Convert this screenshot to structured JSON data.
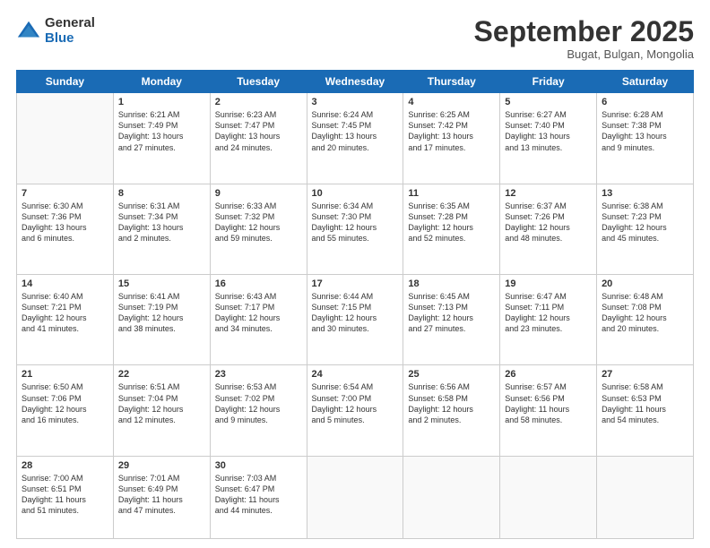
{
  "logo": {
    "general": "General",
    "blue": "Blue"
  },
  "header": {
    "month": "September 2025",
    "location": "Bugat, Bulgan, Mongolia"
  },
  "weekdays": [
    "Sunday",
    "Monday",
    "Tuesday",
    "Wednesday",
    "Thursday",
    "Friday",
    "Saturday"
  ],
  "weeks": [
    [
      {
        "day": "",
        "content": ""
      },
      {
        "day": "1",
        "content": "Sunrise: 6:21 AM\nSunset: 7:49 PM\nDaylight: 13 hours\nand 27 minutes."
      },
      {
        "day": "2",
        "content": "Sunrise: 6:23 AM\nSunset: 7:47 PM\nDaylight: 13 hours\nand 24 minutes."
      },
      {
        "day": "3",
        "content": "Sunrise: 6:24 AM\nSunset: 7:45 PM\nDaylight: 13 hours\nand 20 minutes."
      },
      {
        "day": "4",
        "content": "Sunrise: 6:25 AM\nSunset: 7:42 PM\nDaylight: 13 hours\nand 17 minutes."
      },
      {
        "day": "5",
        "content": "Sunrise: 6:27 AM\nSunset: 7:40 PM\nDaylight: 13 hours\nand 13 minutes."
      },
      {
        "day": "6",
        "content": "Sunrise: 6:28 AM\nSunset: 7:38 PM\nDaylight: 13 hours\nand 9 minutes."
      }
    ],
    [
      {
        "day": "7",
        "content": "Sunrise: 6:30 AM\nSunset: 7:36 PM\nDaylight: 13 hours\nand 6 minutes."
      },
      {
        "day": "8",
        "content": "Sunrise: 6:31 AM\nSunset: 7:34 PM\nDaylight: 13 hours\nand 2 minutes."
      },
      {
        "day": "9",
        "content": "Sunrise: 6:33 AM\nSunset: 7:32 PM\nDaylight: 12 hours\nand 59 minutes."
      },
      {
        "day": "10",
        "content": "Sunrise: 6:34 AM\nSunset: 7:30 PM\nDaylight: 12 hours\nand 55 minutes."
      },
      {
        "day": "11",
        "content": "Sunrise: 6:35 AM\nSunset: 7:28 PM\nDaylight: 12 hours\nand 52 minutes."
      },
      {
        "day": "12",
        "content": "Sunrise: 6:37 AM\nSunset: 7:26 PM\nDaylight: 12 hours\nand 48 minutes."
      },
      {
        "day": "13",
        "content": "Sunrise: 6:38 AM\nSunset: 7:23 PM\nDaylight: 12 hours\nand 45 minutes."
      }
    ],
    [
      {
        "day": "14",
        "content": "Sunrise: 6:40 AM\nSunset: 7:21 PM\nDaylight: 12 hours\nand 41 minutes."
      },
      {
        "day": "15",
        "content": "Sunrise: 6:41 AM\nSunset: 7:19 PM\nDaylight: 12 hours\nand 38 minutes."
      },
      {
        "day": "16",
        "content": "Sunrise: 6:43 AM\nSunset: 7:17 PM\nDaylight: 12 hours\nand 34 minutes."
      },
      {
        "day": "17",
        "content": "Sunrise: 6:44 AM\nSunset: 7:15 PM\nDaylight: 12 hours\nand 30 minutes."
      },
      {
        "day": "18",
        "content": "Sunrise: 6:45 AM\nSunset: 7:13 PM\nDaylight: 12 hours\nand 27 minutes."
      },
      {
        "day": "19",
        "content": "Sunrise: 6:47 AM\nSunset: 7:11 PM\nDaylight: 12 hours\nand 23 minutes."
      },
      {
        "day": "20",
        "content": "Sunrise: 6:48 AM\nSunset: 7:08 PM\nDaylight: 12 hours\nand 20 minutes."
      }
    ],
    [
      {
        "day": "21",
        "content": "Sunrise: 6:50 AM\nSunset: 7:06 PM\nDaylight: 12 hours\nand 16 minutes."
      },
      {
        "day": "22",
        "content": "Sunrise: 6:51 AM\nSunset: 7:04 PM\nDaylight: 12 hours\nand 12 minutes."
      },
      {
        "day": "23",
        "content": "Sunrise: 6:53 AM\nSunset: 7:02 PM\nDaylight: 12 hours\nand 9 minutes."
      },
      {
        "day": "24",
        "content": "Sunrise: 6:54 AM\nSunset: 7:00 PM\nDaylight: 12 hours\nand 5 minutes."
      },
      {
        "day": "25",
        "content": "Sunrise: 6:56 AM\nSunset: 6:58 PM\nDaylight: 12 hours\nand 2 minutes."
      },
      {
        "day": "26",
        "content": "Sunrise: 6:57 AM\nSunset: 6:56 PM\nDaylight: 11 hours\nand 58 minutes."
      },
      {
        "day": "27",
        "content": "Sunrise: 6:58 AM\nSunset: 6:53 PM\nDaylight: 11 hours\nand 54 minutes."
      }
    ],
    [
      {
        "day": "28",
        "content": "Sunrise: 7:00 AM\nSunset: 6:51 PM\nDaylight: 11 hours\nand 51 minutes."
      },
      {
        "day": "29",
        "content": "Sunrise: 7:01 AM\nSunset: 6:49 PM\nDaylight: 11 hours\nand 47 minutes."
      },
      {
        "day": "30",
        "content": "Sunrise: 7:03 AM\nSunset: 6:47 PM\nDaylight: 11 hours\nand 44 minutes."
      },
      {
        "day": "",
        "content": ""
      },
      {
        "day": "",
        "content": ""
      },
      {
        "day": "",
        "content": ""
      },
      {
        "day": "",
        "content": ""
      }
    ]
  ]
}
